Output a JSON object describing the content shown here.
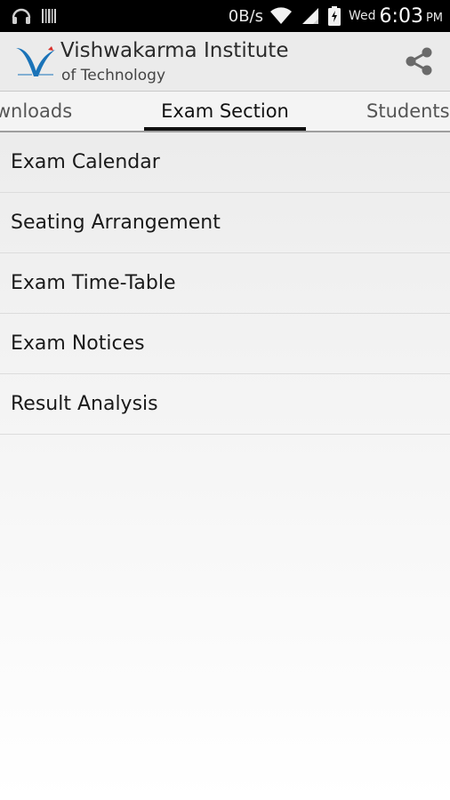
{
  "status_bar": {
    "network_speed": "0B/s",
    "day": "Wed",
    "time": "6:03",
    "ampm": "PM",
    "icons": [
      "headset-icon",
      "barcode-icon",
      "wifi-icon",
      "signal-icon",
      "battery-icon"
    ]
  },
  "app_bar": {
    "title": "Vishwakarma Institute",
    "subtitle": "of Technology",
    "logo_icon": "vit-logo-icon",
    "share_icon": "share-icon"
  },
  "tabs": {
    "left": "ownloads",
    "active": "Exam Section",
    "right": "Students"
  },
  "menu": {
    "items": [
      {
        "label": "Exam Calendar"
      },
      {
        "label": "Seating Arrangement"
      },
      {
        "label": "Exam Time-Table"
      },
      {
        "label": "Exam Notices"
      },
      {
        "label": "Result Analysis"
      }
    ]
  },
  "colors": {
    "status_bar_bg": "#000000",
    "app_bar_bg": "#ebebeb",
    "logo_blue": "#1a73b8",
    "tab_indicator": "#111111"
  }
}
